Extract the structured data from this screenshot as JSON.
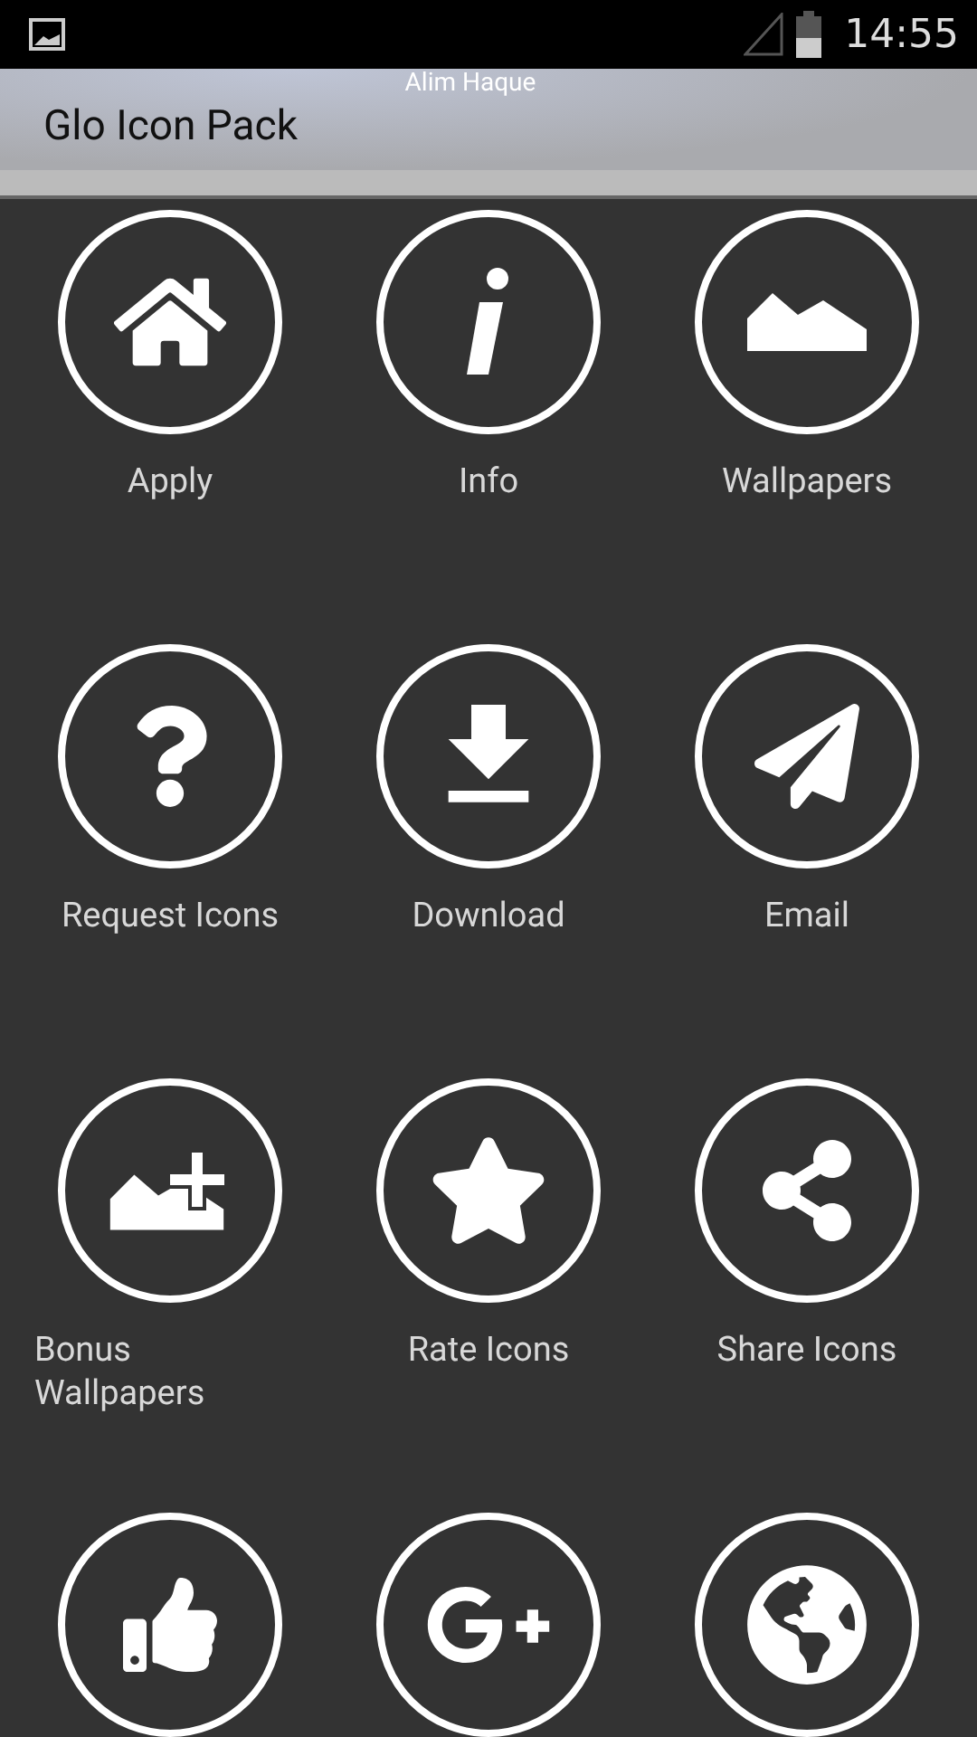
{
  "status_bar": {
    "time": "14:55"
  },
  "header": {
    "subtitle": "Alim Haque",
    "title": "Glo Icon Pack"
  },
  "items": [
    {
      "kind": "home",
      "label": "Apply"
    },
    {
      "kind": "info",
      "label": "Info"
    },
    {
      "kind": "mountain",
      "label": "Wallpapers"
    },
    {
      "kind": "question",
      "label": "Request Icons"
    },
    {
      "kind": "download",
      "label": "Download"
    },
    {
      "kind": "plane",
      "label": "Email"
    },
    {
      "kind": "mountain-plus",
      "label": "Bonus Wallpapers"
    },
    {
      "kind": "star",
      "label": "Rate Icons"
    },
    {
      "kind": "share",
      "label": "Share Icons"
    },
    {
      "kind": "thumb"
    },
    {
      "kind": "gplus"
    },
    {
      "kind": "globe"
    }
  ]
}
